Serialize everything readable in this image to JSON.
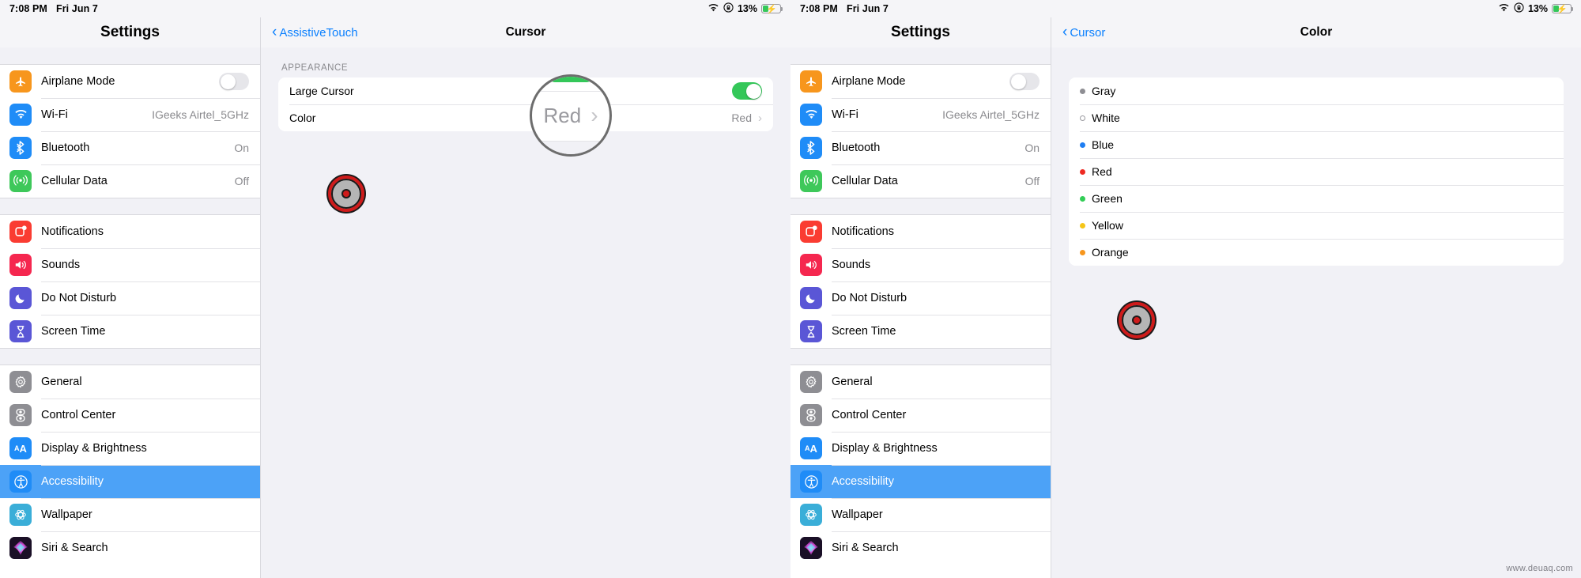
{
  "status_bar": {
    "time": "7:08 PM",
    "date": "Fri Jun 7",
    "wifi_icon": "wifi-icon",
    "lock_icon": "orientation-lock-icon",
    "battery_percent": "13%",
    "battery_charging": true
  },
  "sidebar": {
    "title": "Settings",
    "groups": [
      {
        "items": [
          {
            "label": "Airplane Mode",
            "icon": "airplane-icon",
            "icon_color": "#f7961d",
            "control": "switch",
            "switch_on": false
          },
          {
            "label": "Wi-Fi",
            "icon": "wifi-icon",
            "icon_color": "#1f8cf7",
            "value": "IGeeks Airtel_5GHz"
          },
          {
            "label": "Bluetooth",
            "icon": "bluetooth-icon",
            "icon_color": "#1f8cf7",
            "value": "On"
          },
          {
            "label": "Cellular Data",
            "icon": "cellular-icon",
            "icon_color": "#3ec85a",
            "value": "Off"
          }
        ]
      },
      {
        "items": [
          {
            "label": "Notifications",
            "icon": "notifications-icon",
            "icon_color": "#fa3c32"
          },
          {
            "label": "Sounds",
            "icon": "sounds-icon",
            "icon_color": "#f5274f"
          },
          {
            "label": "Do Not Disturb",
            "icon": "moon-icon",
            "icon_color": "#5a56d6"
          },
          {
            "label": "Screen Time",
            "icon": "hourglass-icon",
            "icon_color": "#5a56d6"
          }
        ]
      },
      {
        "items": [
          {
            "label": "General",
            "icon": "gear-icon",
            "icon_color": "#8e8e93"
          },
          {
            "label": "Control Center",
            "icon": "sliders-icon",
            "icon_color": "#8e8e93"
          },
          {
            "label": "Display & Brightness",
            "icon": "display-brightness-icon",
            "icon_color": "#1f8cf7"
          },
          {
            "label": "Accessibility",
            "icon": "accessibility-icon",
            "icon_color": "#1f8cf7",
            "selected": true
          },
          {
            "label": "Wallpaper",
            "icon": "wallpaper-icon",
            "icon_color": "#3aaed8"
          },
          {
            "label": "Siri & Search",
            "icon": "siri-icon",
            "icon_color": "#2b1b3c"
          }
        ]
      }
    ]
  },
  "pane_cursor": {
    "back_label": "AssistiveTouch",
    "title": "Cursor",
    "section_header": "APPEARANCE",
    "rows": [
      {
        "label": "Large Cursor",
        "control": "switch",
        "switch_on": true
      },
      {
        "label": "Color",
        "value": "Red",
        "chevron": "›"
      }
    ],
    "magnifier": {
      "value_text": "Red",
      "chevron": "›"
    }
  },
  "pane_color": {
    "back_label": "Cursor",
    "title": "Color",
    "options": [
      {
        "label": "Gray",
        "color": "#8e8e93",
        "selected": false
      },
      {
        "label": "White",
        "color": "#ffffff",
        "hollow": true,
        "selected": false
      },
      {
        "label": "Blue",
        "color": "#1f7ef2",
        "selected": false
      },
      {
        "label": "Red",
        "color": "#ee2a22",
        "selected": true
      },
      {
        "label": "Green",
        "color": "#32cd56",
        "selected": false
      },
      {
        "label": "Yellow",
        "color": "#f5c518",
        "selected": false
      },
      {
        "label": "Orange",
        "color": "#f7961d",
        "selected": false
      }
    ],
    "magnifier": {
      "check_icon": "checkmark-icon",
      "check_color": "#0b80fe"
    }
  },
  "cursor_overlay": {
    "name": "assistive-touch-cursor",
    "ring_color": "#cf1b1b",
    "body_color": "#b5b5b5"
  },
  "watermark": "www.deuaq.com"
}
